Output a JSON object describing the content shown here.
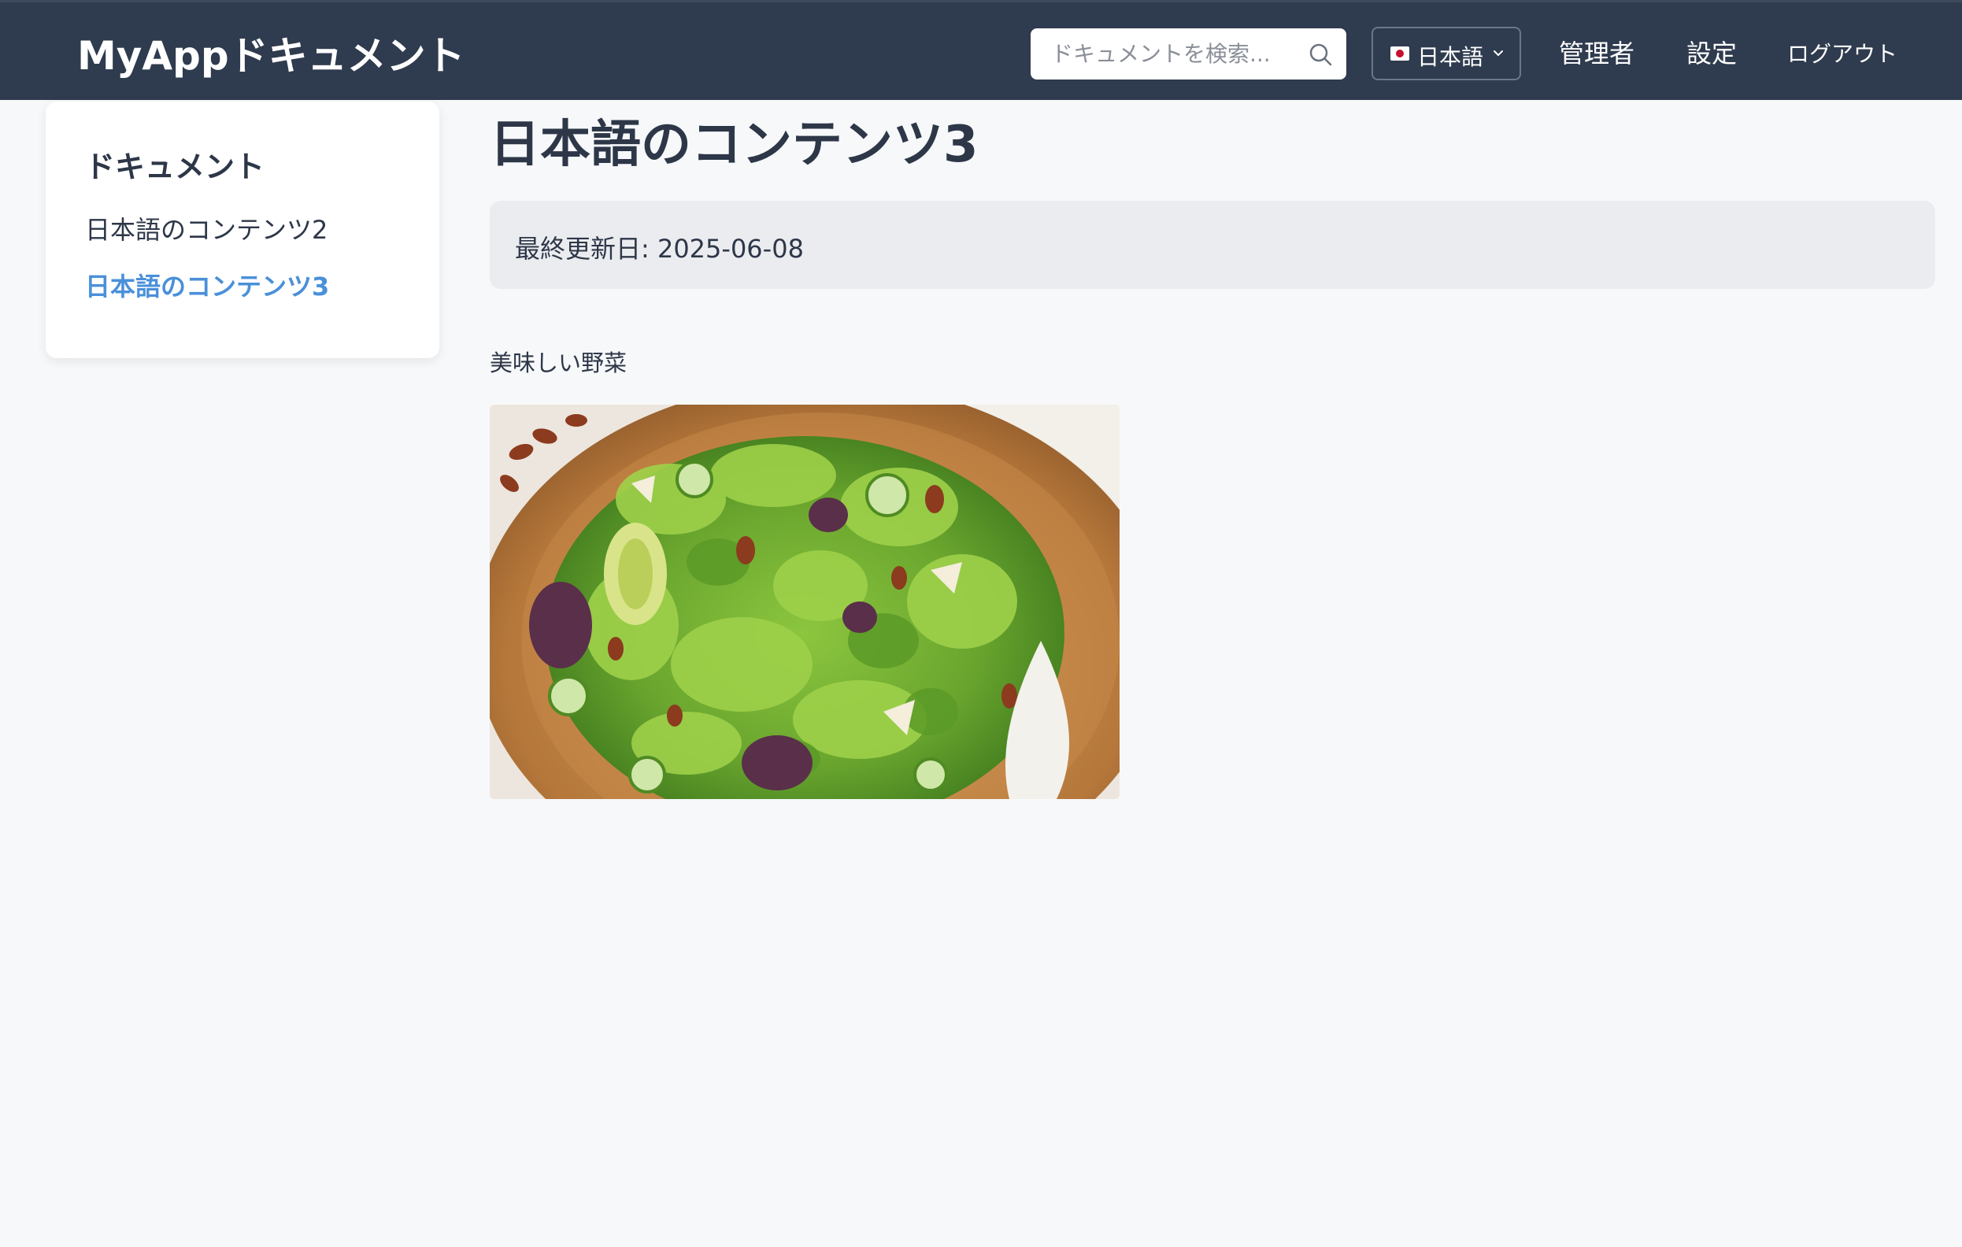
{
  "header": {
    "brand": "MyAppドキュメント",
    "search_placeholder": "ドキュメントを検索...",
    "language": "日本語",
    "nav": {
      "admin": "管理者",
      "settings": "設定",
      "logout": "ログアウト"
    }
  },
  "sidebar": {
    "title": "ドキュメント",
    "items": [
      {
        "label": "日本語のコンテンツ2",
        "active": false
      },
      {
        "label": "日本語のコンテンツ3",
        "active": true
      }
    ]
  },
  "main": {
    "title": "日本語のコンテンツ3",
    "last_updated": "最終更新日: 2025-06-08",
    "image_caption": "美味しい野菜"
  },
  "colors": {
    "header_bg": "#2f3b4e",
    "accent": "#4a90d9",
    "page_bg": "#f7f8fa",
    "meta_bg": "#ebecef"
  }
}
